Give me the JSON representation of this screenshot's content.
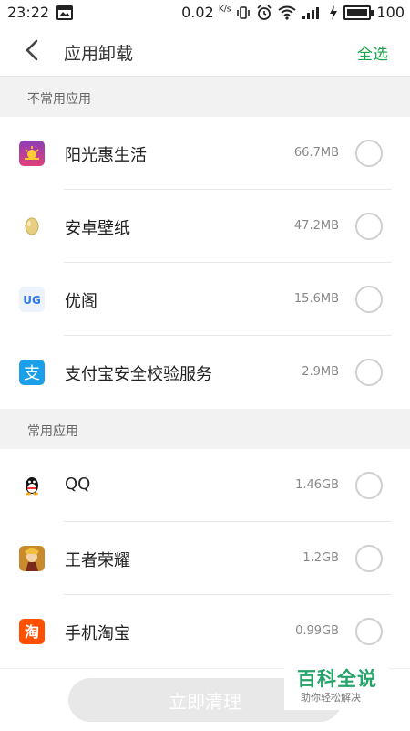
{
  "status": {
    "time": "23:22",
    "speed": "0.02",
    "speed_unit": "K/s",
    "battery": "100"
  },
  "header": {
    "title": "应用卸载",
    "select_all": "全选"
  },
  "sections": [
    {
      "label": "不常用应用",
      "apps": [
        {
          "name": "阳光惠生活",
          "size": "66.7MB"
        },
        {
          "name": "安卓壁纸",
          "size": "47.2MB"
        },
        {
          "name": "优阁",
          "size": "15.6MB"
        },
        {
          "name": "支付宝安全校验服务",
          "size": "2.9MB"
        }
      ]
    },
    {
      "label": "常用应用",
      "apps": [
        {
          "name": "QQ",
          "size": "1.46GB"
        },
        {
          "name": "王者荣耀",
          "size": "1.2GB"
        },
        {
          "name": "手机淘宝",
          "size": "0.99GB"
        }
      ]
    }
  ],
  "button": {
    "clean": "立即清理"
  },
  "watermark": {
    "title": "百科全说",
    "subtitle": "助你轻松解决"
  },
  "icon_glyphs": {
    "alipay": "支",
    "taobao": "淘",
    "youge": "UG"
  },
  "colors": {
    "accent": "#1aa34a"
  }
}
